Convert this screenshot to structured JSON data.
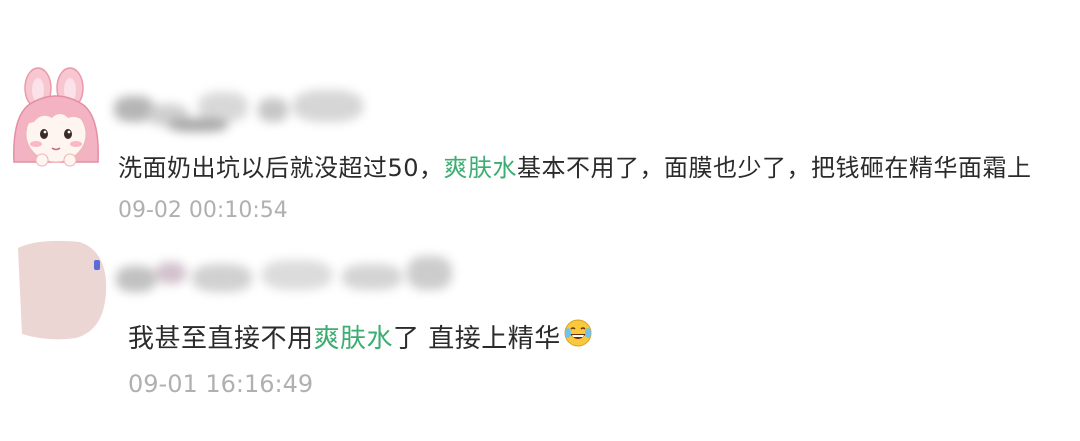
{
  "comments": [
    {
      "text_before": "洗面奶出坑以后就没超过50，",
      "highlight": "爽肤水",
      "text_after": "基本不用了，面膜也少了，把钱砸在精华面霜上",
      "timestamp": "09-02 00:10:54",
      "avatar_icon": "pink-bunny-girl-avatar-icon"
    },
    {
      "text_before": "我甚至直接不用",
      "highlight": "爽肤水",
      "text_after": "了 直接上精华",
      "emoji_icon": "laughing-tears-emoji-icon",
      "timestamp": "09-01 16:16:49",
      "avatar_icon": "blurred-avatar-icon"
    }
  ],
  "colors": {
    "highlight": "#3dae73",
    "timestamp": "#b0b0b0",
    "text": "#2b2b2b"
  }
}
